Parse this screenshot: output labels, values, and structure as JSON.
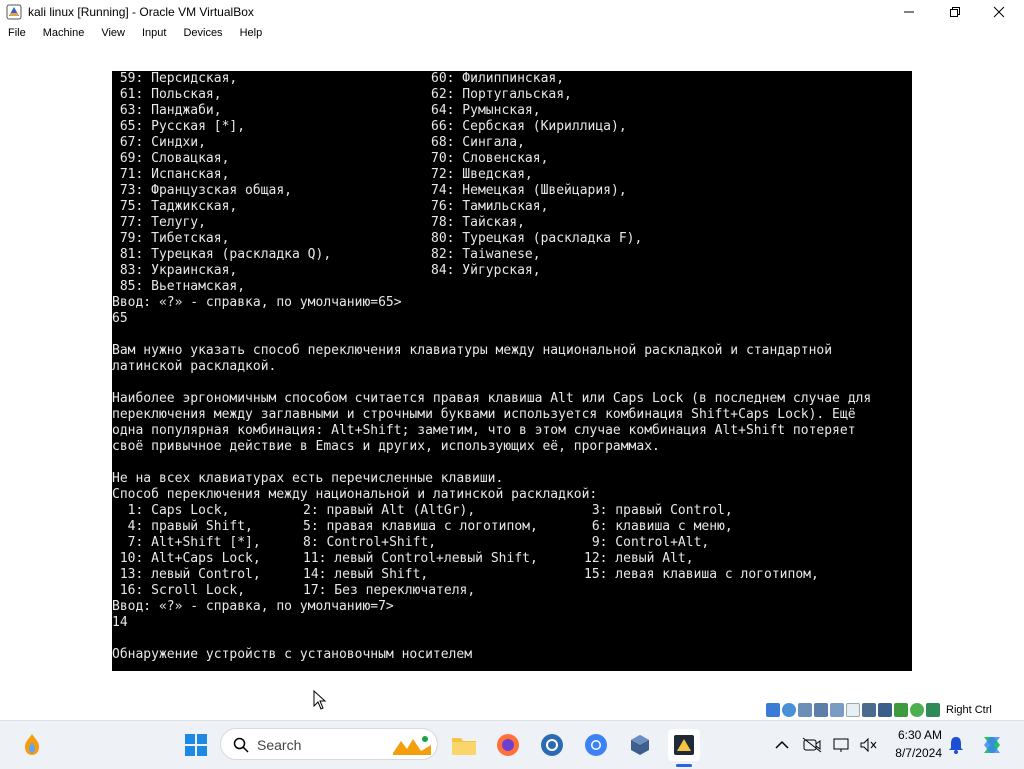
{
  "window": {
    "title": "kali linux [Running] - Oracle VM VirtualBox",
    "minimize_icon": "minimize-icon",
    "maximize_icon": "restore-icon",
    "close_icon": "close-icon"
  },
  "menubar": {
    "items": [
      {
        "label": "File"
      },
      {
        "label": "Machine"
      },
      {
        "label": "View"
      },
      {
        "label": "Input"
      },
      {
        "label": "Devices"
      },
      {
        "label": "Help"
      }
    ]
  },
  "terminal": {
    "list_rows": [
      {
        "left": " 59: Персидская,",
        "right": "60: Филиппинская,"
      },
      {
        "left": " 61: Польская,",
        "right": "62: Португальская,"
      },
      {
        "left": " 63: Панджаби,",
        "right": "64: Румынская,"
      },
      {
        "left": " 65: Русская [*],",
        "right": "66: Сербская (Кириллица),"
      },
      {
        "left": " 67: Синдхи,",
        "right": "68: Сингала,"
      },
      {
        "left": " 69: Словацкая,",
        "right": "70: Словенская,"
      },
      {
        "left": " 71: Испанская,",
        "right": "72: Шведская,"
      },
      {
        "left": " 73: Французская общая,",
        "right": "74: Немецкая (Швейцария),"
      },
      {
        "left": " 75: Таджикская,",
        "right": "76: Тамильская,"
      },
      {
        "left": " 77: Телугу,",
        "right": "78: Тайская,"
      },
      {
        "left": " 79: Тибетская,",
        "right": "80: Турецкая (раскладка F),"
      },
      {
        "left": " 81: Турецкая (раскладка Q),",
        "right": "82: Taiwanese,"
      },
      {
        "left": " 83: Украинская,",
        "right": "84: Уйгурская,"
      },
      {
        "left": " 85: Вьетнамская,",
        "right": ""
      }
    ],
    "prompt1": "Ввод: «?» - справка, по умолчанию=65>",
    "answer1": "65",
    "para1_line1": "Вам нужно указать способ переключения клавиатуры между национальной раскладкой и стандартной",
    "para1_line2": "латинской раскладкой.",
    "para2_line1": "Наиболее эргономичным способом считается правая клавиша Alt или Caps Lock (в последнем случае для",
    "para2_line2": "переключения между заглавными и строчными буквами используется комбинация Shift+Caps Lock). Ещё",
    "para2_line3": "одна популярная комбинация: Alt+Shift; заметим, что в этом случае комбинация Alt+Shift потеряет",
    "para2_line4": "своё привычное действие в Emacs и других, использующих её, программах.",
    "para3_line1": "Не на всех клавиатурах есть перечисленные клавиши.",
    "para3_line2": "Способ переключения между национальной и латинской раскладкой:",
    "option_rows": [
      {
        "c1": "  1: Caps Lock,",
        "c2": "2: правый Alt (AltGr),",
        "c3": " 3: правый Control,"
      },
      {
        "c1": "  4: правый Shift,",
        "c2": "5: правая клавиша с логотипом,",
        "c3": " 6: клавиша с меню,"
      },
      {
        "c1": "  7: Alt+Shift [*],",
        "c2": "8: Control+Shift,",
        "c3": " 9: Control+Alt,"
      },
      {
        "c1": " 10: Alt+Caps Lock,",
        "c2": "11: левый Control+левый Shift,",
        "c3": "12: левый Alt,"
      },
      {
        "c1": " 13: левый Control,",
        "c2": "14: левый Shift,",
        "c3": "15: левая клавиша с логотипом,"
      },
      {
        "c1": " 16: Scroll Lock,",
        "c2": "17: Без переключателя,",
        "c3": ""
      }
    ],
    "prompt2": "Ввод: «?» - справка, по умолчанию=7>",
    "answer2": "14",
    "status_line": "Обнаружение устройств с установочным носителем"
  },
  "statusbar": {
    "host_key": "Right Ctrl",
    "icons": [
      "hard-disk-icon",
      "optical-drive-icon",
      "audio-icon",
      "network-icon",
      "usb-icon",
      "shared-folders-icon",
      "display-icon",
      "video-capture-icon",
      "cpu-icon",
      "mouse-integration-icon",
      "keyboard-icon"
    ]
  },
  "taskbar": {
    "search_placeholder": "Search",
    "time": "6:30 AM",
    "date": "8/7/2024",
    "accent": "#2563eb"
  }
}
